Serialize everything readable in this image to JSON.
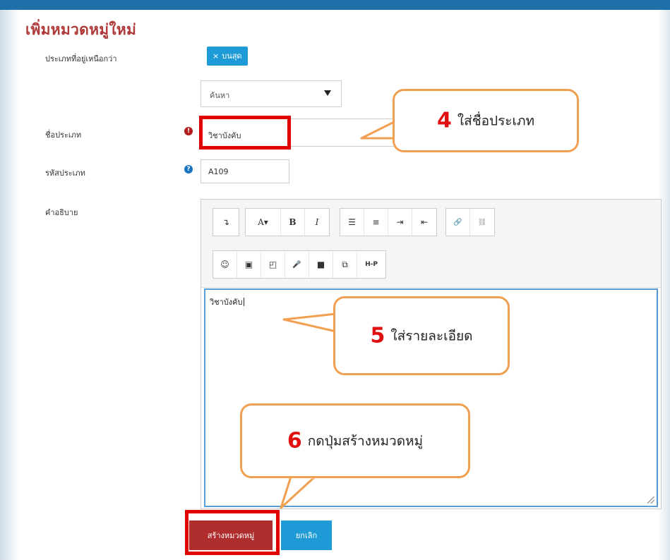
{
  "page": {
    "title": "เพิ่มหมวดหมู่ใหม่"
  },
  "form": {
    "parent_label": "ประเภทที่อยู่เหนือกว่า",
    "parent_tag": "บนสุด",
    "parent_tag_remove": "×",
    "search_select_value": "ค้นหา",
    "name_label": "ชื่อประเภท",
    "name_value": "วิชาบังคับ",
    "id_label": "รหัสประเภท",
    "id_value": "A109",
    "desc_label": "คำอธิบาย",
    "desc_value": "วิชาบังคับ",
    "required_icon": "!",
    "help_icon": "?"
  },
  "toolbar": {
    "row1": [
      [
        {
          "name": "collapse-toolbar-icon",
          "label": "↴"
        }
      ],
      [
        {
          "name": "font-size-icon",
          "label": "A▾"
        },
        {
          "name": "bold-icon",
          "label": "B"
        },
        {
          "name": "italic-icon",
          "label": "I"
        }
      ],
      [
        {
          "name": "bullet-list-icon",
          "label": "☰"
        },
        {
          "name": "numbered-list-icon",
          "label": "≡"
        },
        {
          "name": "indent-icon",
          "label": "⇥"
        },
        {
          "name": "outdent-icon",
          "label": "⇤"
        }
      ],
      [
        {
          "name": "link-icon",
          "label": "🔗"
        },
        {
          "name": "unlink-icon",
          "label": "⛓"
        }
      ]
    ],
    "row2": [
      [
        {
          "name": "emoticon-icon",
          "label": "☺"
        },
        {
          "name": "image-icon",
          "label": "▣"
        },
        {
          "name": "media-icon",
          "label": "◰"
        },
        {
          "name": "record-audio-icon",
          "label": "🎤"
        },
        {
          "name": "record-video-icon",
          "label": "■"
        },
        {
          "name": "manage-files-icon",
          "label": "⧉"
        },
        {
          "name": "h5p-icon",
          "label": "H-P"
        }
      ]
    ]
  },
  "buttons": {
    "create_label": "สร้างหมวดหมู่",
    "cancel_label": "ยกเลิก"
  },
  "callouts": {
    "c4": {
      "number": "4",
      "text": "ใส่ชื่อประเภท"
    },
    "c5": {
      "number": "5",
      "text": "ใส่รายละเอียด"
    },
    "c6": {
      "number": "6",
      "text": "กดปุ่มสร้างหมวดหมู่"
    }
  },
  "colors": {
    "topbar": "#1f6fa8",
    "title": "#b03a3a",
    "tag": "#1e9bd7",
    "highlight": "#e00000",
    "callout_border": "#f0a050",
    "callout_number": "#e01010",
    "create_button": "#b02d2d",
    "cancel_button": "#1e9bd7"
  }
}
